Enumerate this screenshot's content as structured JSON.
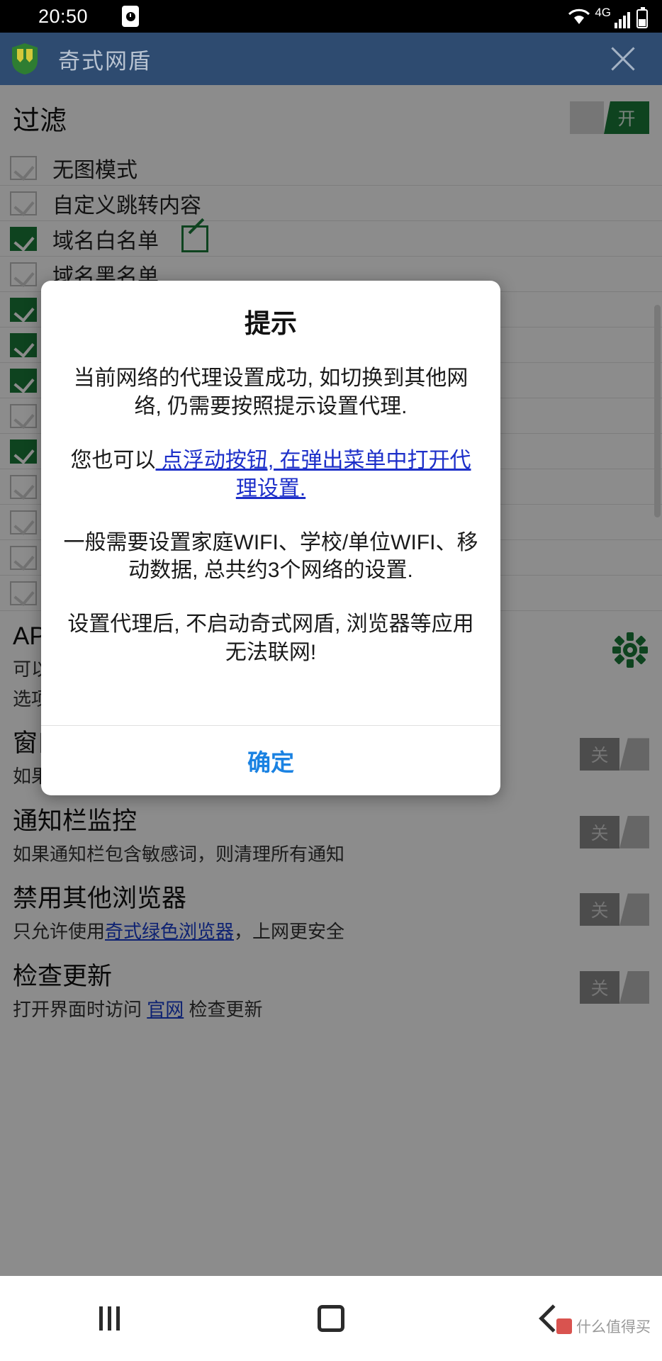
{
  "status_bar": {
    "time": "20:50",
    "clock_icon": "clock-icon",
    "wifi_icon": "wifi-icon",
    "network_label": "4G",
    "signal_icon": "signal-bars-icon",
    "battery_icon": "battery-icon"
  },
  "app_bar": {
    "logo_icon": "shield-icon",
    "title": "奇式网盾",
    "close_icon": "close-icon"
  },
  "filter_section": {
    "label": "过滤",
    "toggle_state": "开",
    "checkboxes": [
      {
        "label": "无图模式",
        "checked": false,
        "edit_icon": false
      },
      {
        "label": "自定义跳转内容",
        "checked": false,
        "edit_icon": false
      },
      {
        "label": "域名白名单",
        "checked": true,
        "edit_icon": true
      },
      {
        "label": "域名黑名单",
        "checked": false,
        "edit_icon": false
      },
      {
        "label": "",
        "checked": true,
        "edit_icon": false
      },
      {
        "label": "",
        "checked": true,
        "edit_icon": false
      },
      {
        "label": "",
        "checked": true,
        "edit_icon": false
      },
      {
        "label": "",
        "checked": false,
        "edit_icon": false
      },
      {
        "label": "",
        "checked": true,
        "edit_icon": false
      },
      {
        "label": "",
        "checked": false,
        "edit_icon": false
      },
      {
        "label": "",
        "checked": false,
        "edit_icon": false
      },
      {
        "label": "",
        "checked": false,
        "edit_icon": false
      },
      {
        "label": "",
        "checked": false,
        "edit_icon": false
      }
    ]
  },
  "settings_rows": [
    {
      "title": "AP",
      "desc_line1": "可以",
      "desc_line2": "选项",
      "control": "gear-icon",
      "toggle_state": ""
    },
    {
      "title": "窗口",
      "desc_line1": "如果",
      "desc_line2": "",
      "control": "toggle",
      "toggle_state": "关"
    },
    {
      "title": "通知栏监控",
      "desc_line1": "如果通知栏包含敏感词，则清理所有通知",
      "desc_line2": "",
      "control": "toggle",
      "toggle_state": "关"
    },
    {
      "title": "禁用其他浏览器",
      "desc_prefix": "只允许使用",
      "desc_link": "奇式绿色浏览器",
      "desc_suffix": "，上网更安全",
      "control": "toggle",
      "toggle_state": "关"
    },
    {
      "title": "检查更新",
      "desc_prefix": "打开界面时访问 ",
      "desc_link": "官网",
      "desc_suffix": " 检查更新",
      "control": "toggle",
      "toggle_state": "关"
    }
  ],
  "dialog": {
    "title": "提示",
    "paragraph1": "当前网络的代理设置成功, 如切换到其他网络, 仍需要按照提示设置代理.",
    "paragraph2_prefix": "您也可以",
    "paragraph2_link": " 点浮动按钮, 在弹出菜单中打开代理设置.",
    "paragraph3": "一般需要设置家庭WIFI、学校/单位WIFI、移动数据, 总共约3个网络的设置.",
    "paragraph4": "设置代理后, 不启动奇式网盾, 浏览器等应用无法联网!",
    "confirm_label": "确定"
  },
  "nav_bar": {
    "recent_icon": "recent-apps-icon",
    "home_icon": "home-icon",
    "back_icon": "back-icon"
  },
  "watermark": {
    "text": "什么值得买"
  },
  "colors": {
    "app_bar": "#2e4b70",
    "accent_green": "#1b7a3a",
    "link_blue": "#1d2fc9",
    "button_blue": "#1a82e2",
    "toggle_off": "#8b8b8b"
  }
}
